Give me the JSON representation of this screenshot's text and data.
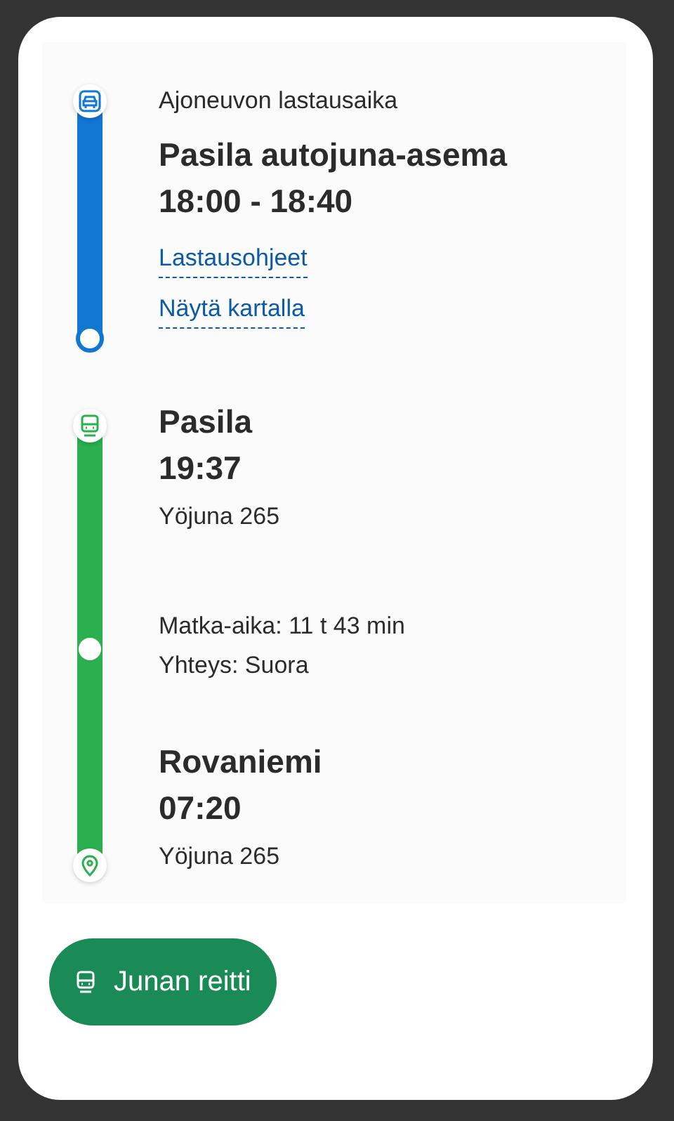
{
  "segments": [
    {
      "kind": "loading",
      "color": "#1276d3",
      "label": "Ajoneuvon lastausaika",
      "station": "Pasila autojuna-asema",
      "time": "18:00 - 18:40",
      "links": [
        "Lastausohjeet",
        "Näytä kartalla"
      ]
    },
    {
      "kind": "train",
      "color": "#2bb04f",
      "departure": {
        "station": "Pasila",
        "time": "19:37",
        "train": "Yöjuna 265"
      },
      "duration": "Matka-aika: 11 t 43 min",
      "connection": "Yhteys: Suora",
      "arrival": {
        "station": "Rovaniemi",
        "time": "07:20",
        "train": "Yöjuna 265"
      }
    }
  ],
  "button": {
    "label": "Junan reitti"
  }
}
